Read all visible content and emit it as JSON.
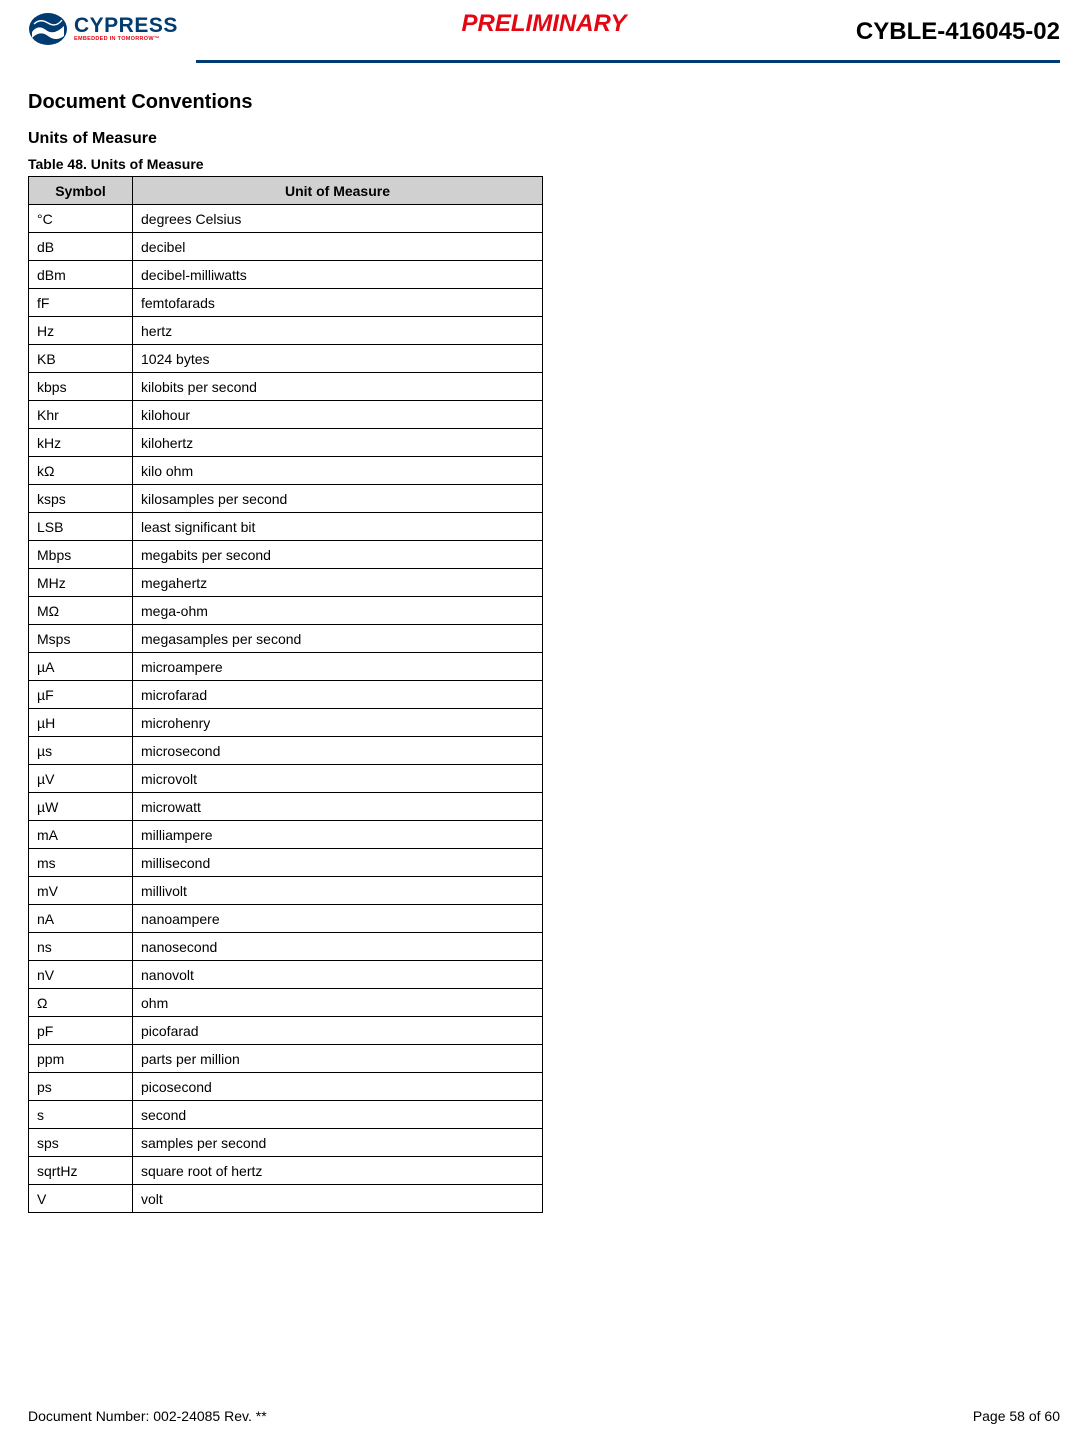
{
  "header": {
    "logo_main": "CYPRESS",
    "logo_tagline": "EMBEDDED IN TOMORROW™",
    "preliminary": "PRELIMINARY",
    "part_number": "CYBLE-416045-02"
  },
  "section_title": "Document Conventions",
  "subsection_title": "Units of Measure",
  "table_caption": "Table 48.  Units of Measure",
  "table": {
    "headers": {
      "symbol": "Symbol",
      "unit": "Unit of Measure"
    },
    "rows": [
      {
        "symbol": "°C",
        "unit": "degrees Celsius"
      },
      {
        "symbol": "dB",
        "unit": "decibel"
      },
      {
        "symbol": "dBm",
        "unit": "decibel-milliwatts"
      },
      {
        "symbol": "fF",
        "unit": "femtofarads"
      },
      {
        "symbol": "Hz",
        "unit": "hertz"
      },
      {
        "symbol": "KB",
        "unit": "1024 bytes"
      },
      {
        "symbol": "kbps",
        "unit": "kilobits per second"
      },
      {
        "symbol": "Khr",
        "unit": "kilohour"
      },
      {
        "symbol": "kHz",
        "unit": "kilohertz"
      },
      {
        "symbol": "kΩ",
        "unit": "kilo ohm"
      },
      {
        "symbol": "ksps",
        "unit": "kilosamples per second"
      },
      {
        "symbol": "LSB",
        "unit": "least significant bit"
      },
      {
        "symbol": "Mbps",
        "unit": "megabits per second"
      },
      {
        "symbol": "MHz",
        "unit": "megahertz"
      },
      {
        "symbol": "MΩ",
        "unit": "mega-ohm"
      },
      {
        "symbol": "Msps",
        "unit": "megasamples per second"
      },
      {
        "symbol": "µA",
        "unit": "microampere"
      },
      {
        "symbol": "µF",
        "unit": "microfarad"
      },
      {
        "symbol": "µH",
        "unit": "microhenry"
      },
      {
        "symbol": "µs",
        "unit": "microsecond"
      },
      {
        "symbol": "µV",
        "unit": "microvolt"
      },
      {
        "symbol": "µW",
        "unit": "microwatt"
      },
      {
        "symbol": "mA",
        "unit": "milliampere"
      },
      {
        "symbol": "ms",
        "unit": "millisecond"
      },
      {
        "symbol": "mV",
        "unit": "millivolt"
      },
      {
        "symbol": "nA",
        "unit": "nanoampere"
      },
      {
        "symbol": "ns",
        "unit": "nanosecond"
      },
      {
        "symbol": "nV",
        "unit": "nanovolt"
      },
      {
        "symbol": "Ω",
        "unit": "ohm"
      },
      {
        "symbol": "pF",
        "unit": "picofarad"
      },
      {
        "symbol": "ppm",
        "unit": "parts per million"
      },
      {
        "symbol": "ps",
        "unit": "picosecond"
      },
      {
        "symbol": "s",
        "unit": "second"
      },
      {
        "symbol": "sps",
        "unit": "samples per second"
      },
      {
        "symbol": "sqrtHz",
        "unit": "square root of hertz"
      },
      {
        "symbol": "V",
        "unit": "volt"
      }
    ]
  },
  "footer": {
    "doc_number": "Document Number: 002-24085 Rev. **",
    "page": "Page 58 of 60"
  }
}
